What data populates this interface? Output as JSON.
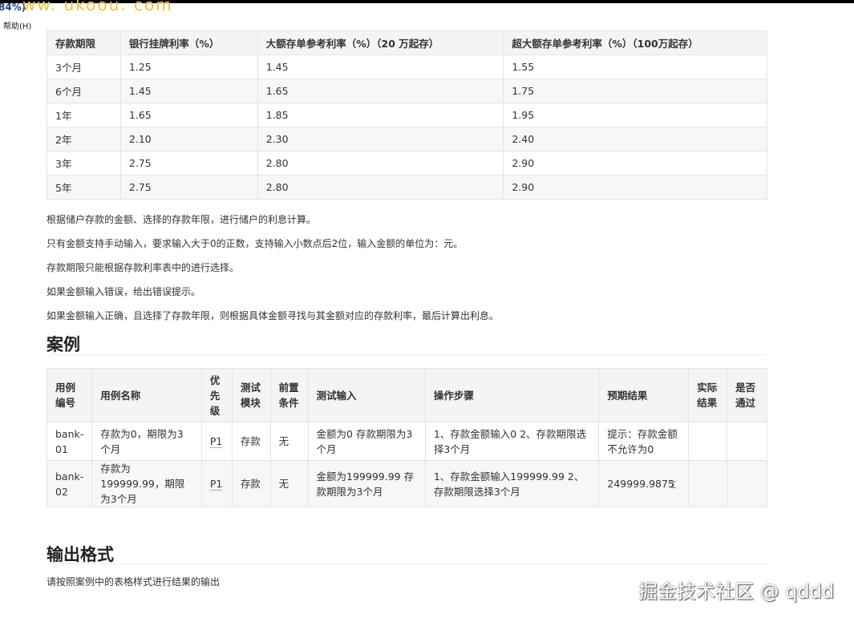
{
  "header": {
    "corner_badge": "84%)",
    "watermark_top": "ww. ukoou. com",
    "help_menu": "帮助(H)"
  },
  "rate_table": {
    "headers": [
      "存款期限",
      "银行挂牌利率（%）",
      "大额存单参考利率（%）（20 万起存）",
      "超大额存单参考利率（%）（100万起存）"
    ],
    "rows": [
      [
        "3个月",
        "1.25",
        "1.45",
        "1.55"
      ],
      [
        "6个月",
        "1.45",
        "1.65",
        "1.75"
      ],
      [
        "1年",
        "1.65",
        "1.85",
        "1.95"
      ],
      [
        "2年",
        "2.10",
        "2.30",
        "2.40"
      ],
      [
        "3年",
        "2.75",
        "2.80",
        "2.90"
      ],
      [
        "5年",
        "2.75",
        "2.80",
        "2.90"
      ]
    ]
  },
  "requirements": [
    "根据储户存款的金额、选择的存款年限，进行储户的利息计算。",
    "只有金额支持手动输入，要求输入大于0的正数，支持输入小数点后2位，输入金额的单位为：元。",
    "存款期限只能根据存款利率表中的进行选择。",
    "如果金额输入错误，给出错误提示。",
    "如果金额输入正确，且选择了存款年限，则根据具体金额寻找与其金额对应的存款利率，最后计算出利息。"
  ],
  "case_section": {
    "title": "案例",
    "headers": [
      "用例编号",
      "用例名称",
      "优先级",
      "测试模块",
      "前置条件",
      "测试输入",
      "操作步骤",
      "预期结果",
      "实际结果",
      "是否通过"
    ],
    "rows": [
      [
        "bank-01",
        "存款为0，期限为3个月",
        "P1",
        "存款",
        "无",
        "金额为0 存款期限为3个月",
        "1、存款金额输入0 2、存款期限选择3个月",
        "提示：存款金额不允许为0",
        "",
        ""
      ],
      [
        "bank-02",
        "存款为199999.99，期限为3个月",
        "P1",
        "存款",
        "无",
        "金额为199999.99 存款期限为3个月",
        "1、存款金额输入199999.99 2、存款期限选择3个月",
        "249999.9875",
        "",
        ""
      ]
    ]
  },
  "output_section": {
    "title": "输出格式",
    "text": "请按照案例中的表格样式进行结果的输出"
  },
  "footer": {
    "watermark": "掘金技术社区 @ qddd"
  }
}
